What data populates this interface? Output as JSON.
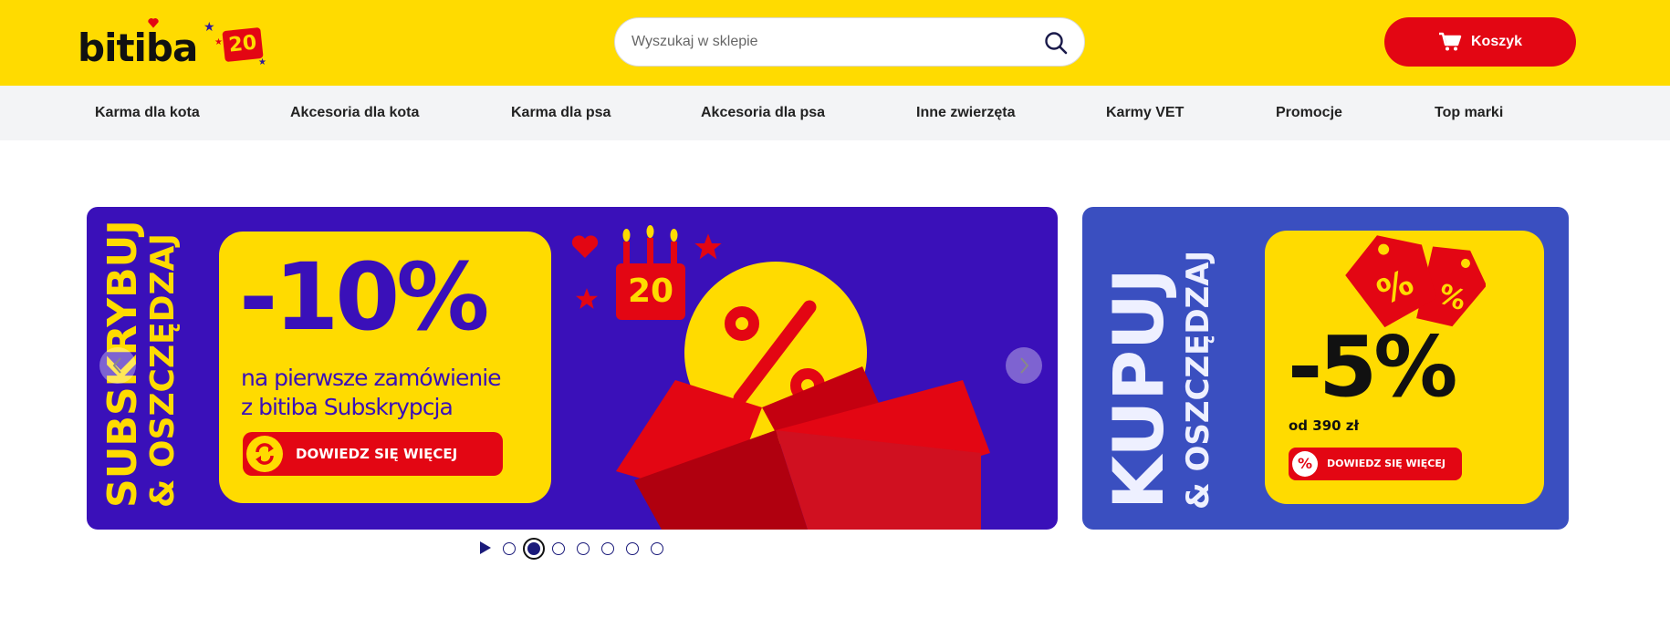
{
  "header": {
    "logo_text": "bitiba",
    "logo_badge": "20",
    "search": {
      "placeholder": "Wyszukaj w sklepie",
      "value": ""
    },
    "search_icon": "magnifier-icon",
    "cart": {
      "label": "Koszyk",
      "icon": "cart-icon"
    }
  },
  "nav": {
    "items": [
      {
        "label": "Karma dla kota"
      },
      {
        "label": "Akcesoria dla kota"
      },
      {
        "label": "Karma dla psa"
      },
      {
        "label": "Akcesoria dla psa"
      },
      {
        "label": "Inne zwierzęta"
      },
      {
        "label": "Karmy VET"
      },
      {
        "label": "Promocje"
      },
      {
        "label": "Top marki"
      }
    ]
  },
  "carousel": {
    "slide": {
      "vertical_line1": "SUBSKRYBUJ",
      "vertical_line2": "& OSZCZĘDZAJ",
      "discount": "-10%",
      "subtitle_line1": "na pierwsze zamówienie",
      "subtitle_line2": "z bitiba Subskrypcja",
      "cta_label": "DOWIEDZ SIĘ WIĘCEJ",
      "cake_number": "20",
      "badge_symbol": "%"
    },
    "prev_icon": "chevron-left-icon",
    "next_icon": "chevron-right-icon",
    "dots": {
      "count": 7,
      "active_index": 1
    },
    "play_icon": "play-icon"
  },
  "side_banner": {
    "vertical_line1": "KUPUJ",
    "vertical_line2": "& OSZCZĘDZAJ",
    "discount": "-5%",
    "subtitle": "od 390 zł",
    "cta_label": "DOWIEDZ SIĘ WIĘCEJ",
    "cta_symbol": "%",
    "tag_symbol": "%"
  },
  "colors": {
    "header_bg": "#ffdb00",
    "nav_bg": "#f3f4f6",
    "cart_red": "#e30613",
    "carousel_purple": "#3a10b9",
    "side_blue": "#3a4fc0"
  }
}
